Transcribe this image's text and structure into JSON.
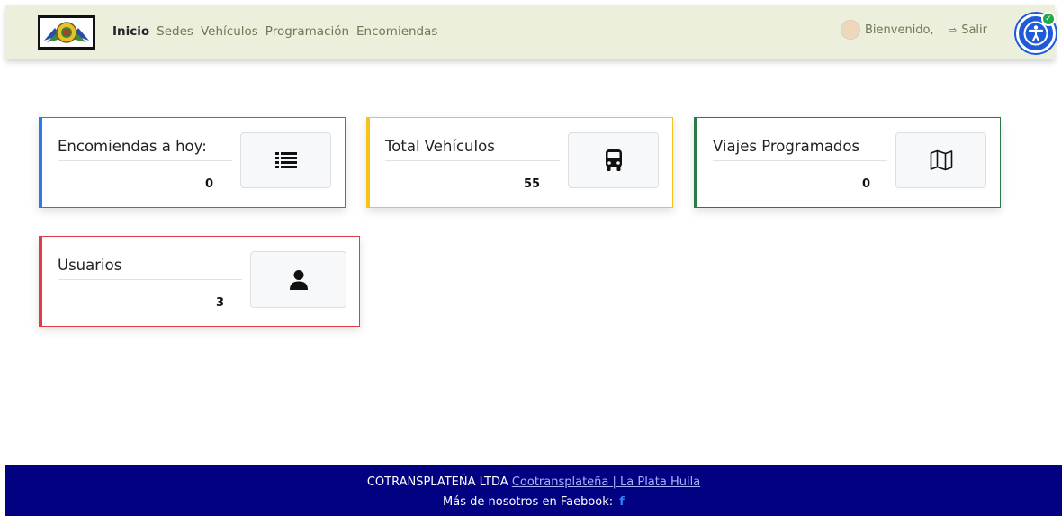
{
  "navbar": {
    "logo": "logo",
    "links": [
      {
        "label": "Inicio",
        "active": true
      },
      {
        "label": "Sedes",
        "active": false
      },
      {
        "label": "Vehículos",
        "active": false
      },
      {
        "label": "Programación",
        "active": false
      },
      {
        "label": "Encomiendas",
        "active": false
      }
    ],
    "welcome": "Bienvenido,",
    "logout": "Salir"
  },
  "cards": {
    "encomiendas": {
      "title": "Encomiendas a hoy:",
      "value": "0",
      "color": "#2c7be5",
      "icon": "list-icon"
    },
    "vehiculos": {
      "title": "Total Vehículos",
      "value": "55",
      "color": "#f7c31a",
      "icon": "bus-icon"
    },
    "viajes": {
      "title": "Viajes Programados",
      "value": "0",
      "color": "#2b7a4b",
      "icon": "map-icon"
    },
    "usuarios": {
      "title": "Usuarios",
      "value": "3",
      "color": "#dc3d4c",
      "icon": "user-icon"
    }
  },
  "footer": {
    "company": "COTRANSPLATEÑA LTDA",
    "link": "Cootransplateña | La Plata Huila",
    "facebook_text": "Más de nosotros en Faebook:",
    "facebook_icon": "f"
  },
  "accessibility": {
    "icon": "accessibility-icon",
    "check": "✓"
  }
}
